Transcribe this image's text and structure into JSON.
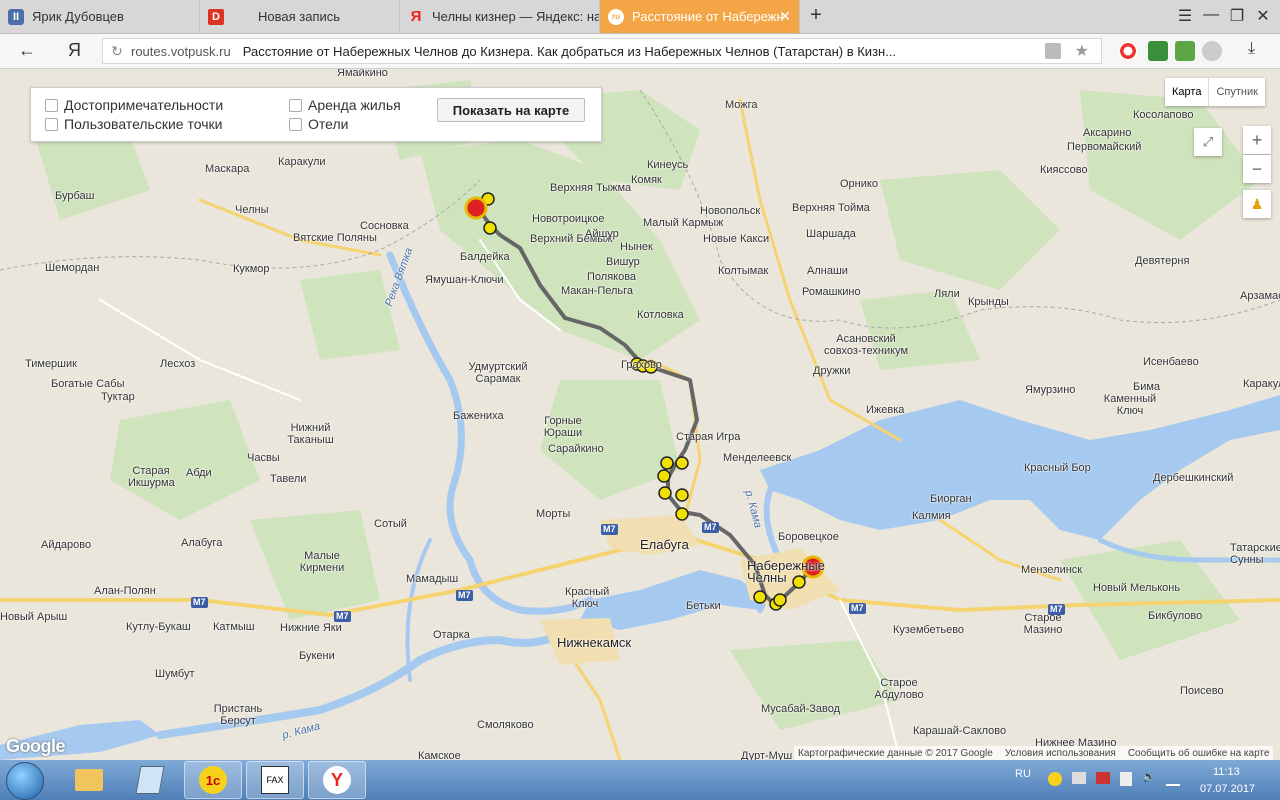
{
  "browser": {
    "tabs": [
      {
        "label": "Ярик Дубовцев",
        "icon": "vk-pause-icon"
      },
      {
        "label": "Новая запись",
        "icon": "d-icon"
      },
      {
        "label": "Челны кизнер — Яндекс: на",
        "icon": "yandex-icon"
      },
      {
        "label": "Расстояние от Набережн",
        "icon": "votpusk-icon",
        "active": true
      }
    ],
    "new_tab": "+",
    "address": {
      "domain": "routes.votpusk.ru",
      "title": "Расстояние от Набережных Челнов до Кизнера. Как добраться из Набережных Челнов (Татарстан) в Кизн..."
    },
    "ya_label": "Я"
  },
  "map_panel": {
    "checkboxes": [
      "Достопримечательности",
      "Пользовательские точки",
      "Аренда жилья",
      "Отели"
    ],
    "show_button": "Показать на карте"
  },
  "map_controls": {
    "map_type": [
      "Карта",
      "Спутник"
    ],
    "zoom_in": "+",
    "zoom_out": "−"
  },
  "map_labels": {
    "places": [
      "Ямайкино",
      "Можга",
      "Косолапово",
      "Аксарино",
      "Первомайский",
      "Кияссово",
      "Маскара",
      "Каракули",
      "Кинеусь",
      "Комяк",
      "Орнико",
      "Бурбаш",
      "Верхняя Тыжма",
      "Новотроицкое",
      "Новопольск",
      "Верхняя Тойма",
      "Челны",
      "Сосновка",
      "Вятские Поляны",
      "Малый Кармыж",
      "Шаршада",
      "Верхний Бемыж",
      "Айшур",
      "Нынек",
      "Новые Какси",
      "Кукмор",
      "Шемордан",
      "Балдейка",
      "Вишур",
      "Девятерня",
      "Ямушан-Ключи",
      "Полякова",
      "Колтымак",
      "Алнаши",
      "Макан-Пельга",
      "Ромашкино",
      "Ляли",
      "Крынды",
      "Арзамас",
      "Котловка",
      "Асановский совхоз-техникум",
      "Тимершик",
      "Лесхоз",
      "Удмуртский Сарамак",
      "Грахово",
      "Дружки",
      "Исенбаево",
      "Богатые Сабы",
      "Туктар",
      "Ямурзино",
      "Бима",
      "Каракул",
      "Ижевка",
      "Каменный Ключ",
      "Баженихa",
      "Горные Юраши",
      "Нижний Таканыш",
      "Старая Игра",
      "Сарайкино",
      "Менделеевск",
      "Красный Бор",
      "Дербешкинский",
      "Старая Икшурма",
      "Абди",
      "Часвы",
      "Тавели",
      "Биорган",
      "Калмия",
      "Морты",
      "Сотый",
      "Боровецкое",
      "Елабуга",
      "Айдарово",
      "Алабуга",
      "Малые Кирмени",
      "Набережные Челны",
      "Мензелинск",
      "Татарские Сунны",
      "Алан-Полян",
      "Мамадыш",
      "Красный Ключ",
      "Бетьки",
      "Новый Мельконь",
      "Новый Арыш",
      "Кутлу-Букаш",
      "Катмыш",
      "Нижние Яки",
      "Отарка",
      "Нижнекамск",
      "Кузембетьево",
      "Старое Мазино",
      "Бикбулово",
      "Букени",
      "Шумбут",
      "Старое Абдулово",
      "Поисево",
      "Пристань Берсут",
      "Смоляково",
      "Мусабай-Завод",
      "Карашай-Саклово",
      "Камское",
      "Нижнее Мазино",
      "Дурт-Муш",
      "Старое Мазино"
    ],
    "rivers": [
      "Река Вятка",
      "р. Кама",
      "р. Кама"
    ],
    "road": "M7"
  },
  "map_footer": {
    "data": "Картографические данные © 2017 Google",
    "terms": "Условия использования",
    "report": "Сообщить об ошибке на карте",
    "google": "Google"
  },
  "taskbar": {
    "apps": [
      "explorer-icon",
      "file-icon",
      "1c-icon",
      "fax-icon",
      "yandex-browser-icon"
    ],
    "lang": "RU",
    "time": "11:13",
    "date": "07.07.2017"
  }
}
